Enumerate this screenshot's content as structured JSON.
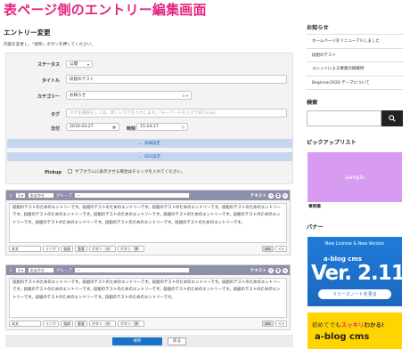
{
  "page_title": "表ページ側のエントリー編集画面",
  "main": {
    "heading": "エントリー変更",
    "description": "内容を変更し、「保存」ボタンを押してください。",
    "form": {
      "status_label": "ステータス",
      "status_value": "公開",
      "title_label": "タイトル",
      "title_value": "段組のテスト",
      "category_label": "カテゴリー",
      "category_value": "お知らせ",
      "tag_label": "タグ",
      "tag_placeholder": "タグを選択もしくは、新しいタグを入力します。（キーワードを入力で絞り込み）",
      "date_label": "日付",
      "date_value": "2019-03-27",
      "time_label": "時刻",
      "time_value": "15:24:17",
      "detail_settings": "詳細設定",
      "seo_settings": "SEO設定",
      "pickup_label": "Pickup",
      "pickup_text": "サブカラムに表示させる場合はチェックを入れてください。"
    },
    "units": [
      {
        "order": "1",
        "align": "おまかせ",
        "group_label": "グループ",
        "group_value": "---",
        "type_label": "テキスト",
        "body": "段組のテストのためのエントリーです。段組のテストのためのエントリーです。段組のテストのためのエントリーです。段組のテストのためのエントリーです。段組のテストのためのエントリーです。段組のテストのためのエントリーです。段組のテストのためのエントリーです。段組のテストのためのエントリーです。段組のテストのためのエントリーです。段組のテストのためのエントリーです。段組のテストのためのエントリーです。",
        "tag_select": "本文",
        "buttons": [
          "リンク",
          "強調",
          "重要",
          "ボタン",
          "灰",
          "ボタン",
          "黄"
        ],
        "abc": "abc",
        "code": "<>"
      },
      {
        "order": "2",
        "align": "おまかせ",
        "group_label": "グループ",
        "group_value": "---",
        "type_label": "テキスト",
        "body": "段組のテストのためのエントリーです。段組のテストのためのエントリーです。段組のテストのためのエントリーです。段組のテストのためのエントリーです。段組のテストのためのエントリーです。段組のテストのためのエントリーです。段組のテストのためのエントリーです。段組のテストのためのエントリーです。段組のテストのためのエントリーです。段組のテストのためのエントリーです。",
        "tag_select": "本文",
        "buttons": [
          "リンク",
          "強調",
          "重要",
          "ボタン",
          "灰",
          "ボタン",
          "黄"
        ],
        "abc": "abc",
        "code": "<>"
      }
    ],
    "save_label": "保存",
    "back_label": "戻る"
  },
  "sidebar": {
    "news_heading": "お知らせ",
    "news_items": [
      "ホームページをリニューアルしました",
      "段組のテスト",
      "ユニットによる要素の掲載例",
      "Beginner2020 テーマについて"
    ],
    "search_heading": "検索",
    "pickup_heading": "ピックアップリスト",
    "pickup_image_text": "sample",
    "pickup_caption": "事務職",
    "banner_heading": "バナー",
    "banner1": {
      "line1": "New License & New Version",
      "logo": "a-blog cms",
      "version": "Ver. 2.11",
      "button": "リリースノートを見る"
    },
    "banner2": {
      "line1_pre": "初めてでも",
      "line1_em": "スッキリ",
      "line1_post": "わかる!",
      "logo": "a-blog cms"
    }
  },
  "colors": {
    "title_pink": "#e5247e",
    "unit_header": "#8d8fab",
    "save_blue": "#1a73c8",
    "banner_blue": "#1b67bf",
    "banner_yellow": "#ffd400",
    "pickup_purple": "#d79bf2"
  }
}
